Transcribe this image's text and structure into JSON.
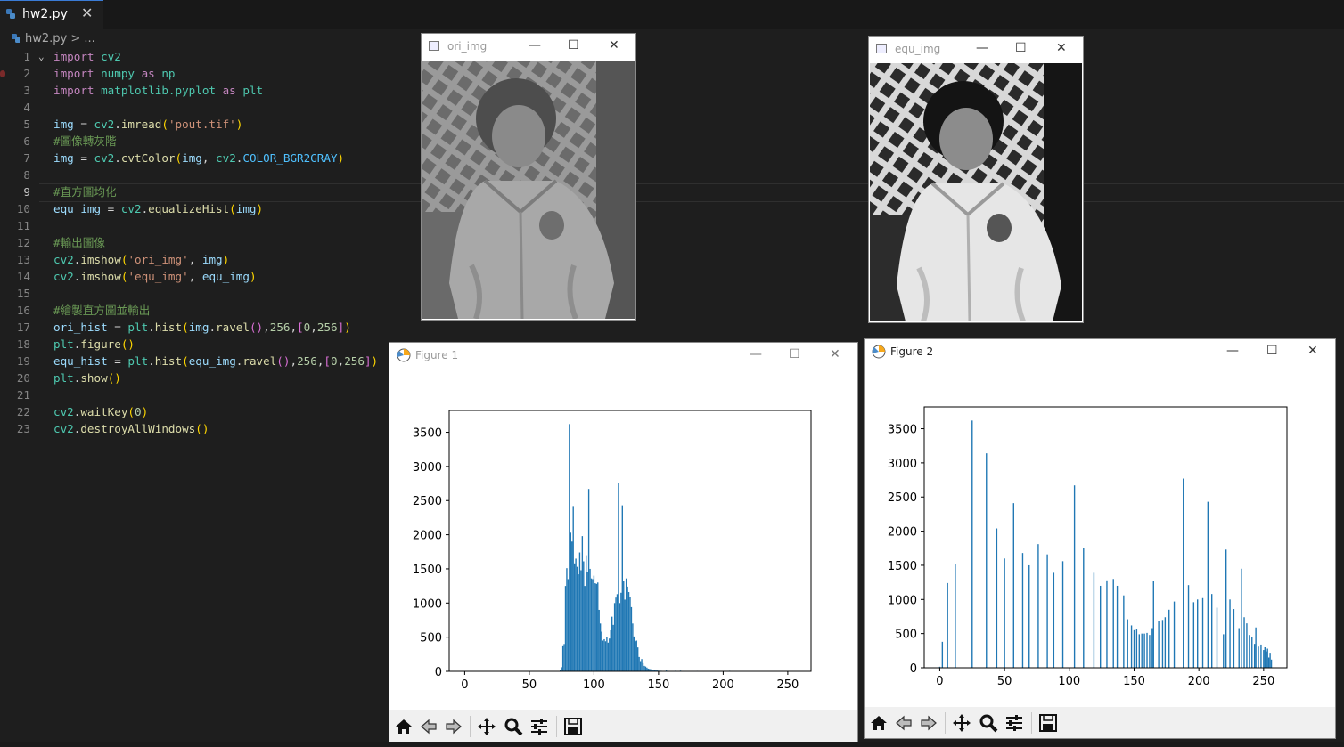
{
  "editor": {
    "tab_label": "hw2.py",
    "tab_close": "✕",
    "breadcrumb": "hw2.py > ...",
    "lines": [
      {
        "n": "1",
        "t": [
          [
            "kw",
            "import"
          ],
          [
            "",
            ""
          ],
          [
            "mod",
            " cv2"
          ]
        ]
      },
      {
        "n": "2",
        "t": [
          [
            "kw",
            "import"
          ],
          [
            "mod",
            " numpy"
          ],
          [
            "kw",
            " as"
          ],
          [
            "mod",
            " np"
          ]
        ]
      },
      {
        "n": "3",
        "t": [
          [
            "kw",
            "import"
          ],
          [
            "mod",
            " matplotlib.pyplot"
          ],
          [
            "kw",
            " as"
          ],
          [
            "mod",
            " plt"
          ]
        ]
      },
      {
        "n": "4",
        "t": []
      },
      {
        "n": "5",
        "t": [
          [
            "var",
            "img"
          ],
          [
            "",
            " = "
          ],
          [
            "mod",
            "cv2"
          ],
          [
            "",
            "."
          ],
          [
            "fn",
            "imread"
          ],
          [
            "p1",
            "("
          ],
          [
            "str",
            "'pout.tif'"
          ],
          [
            "p1",
            ")"
          ]
        ]
      },
      {
        "n": "6",
        "t": [
          [
            "cm",
            "#圖像轉灰階"
          ]
        ]
      },
      {
        "n": "7",
        "t": [
          [
            "var",
            "img"
          ],
          [
            "",
            " = "
          ],
          [
            "mod",
            "cv2"
          ],
          [
            "",
            "."
          ],
          [
            "fn",
            "cvtColor"
          ],
          [
            "p1",
            "("
          ],
          [
            "var",
            "img"
          ],
          [
            "",
            ", "
          ],
          [
            "mod",
            "cv2"
          ],
          [
            "",
            "."
          ],
          [
            "cst",
            "COLOR_BGR2GRAY"
          ],
          [
            "p1",
            ")"
          ]
        ]
      },
      {
        "n": "8",
        "t": []
      },
      {
        "n": "9",
        "t": [
          [
            "cm",
            "#直方圖均化"
          ]
        ]
      },
      {
        "n": "10",
        "t": [
          [
            "var",
            "equ_img"
          ],
          [
            "",
            " = "
          ],
          [
            "mod",
            "cv2"
          ],
          [
            "",
            "."
          ],
          [
            "fn",
            "equalizeHist"
          ],
          [
            "p1",
            "("
          ],
          [
            "var",
            "img"
          ],
          [
            "p1",
            ")"
          ]
        ]
      },
      {
        "n": "11",
        "t": []
      },
      {
        "n": "12",
        "t": [
          [
            "cm",
            "#輸出圖像"
          ]
        ]
      },
      {
        "n": "13",
        "t": [
          [
            "mod",
            "cv2"
          ],
          [
            "",
            "."
          ],
          [
            "fn",
            "imshow"
          ],
          [
            "p1",
            "("
          ],
          [
            "str",
            "'ori_img'"
          ],
          [
            "",
            ", "
          ],
          [
            "var",
            "img"
          ],
          [
            "p1",
            ")"
          ]
        ]
      },
      {
        "n": "14",
        "t": [
          [
            "mod",
            "cv2"
          ],
          [
            "",
            "."
          ],
          [
            "fn",
            "imshow"
          ],
          [
            "p1",
            "("
          ],
          [
            "str",
            "'equ_img'"
          ],
          [
            "",
            ", "
          ],
          [
            "var",
            "equ_img"
          ],
          [
            "p1",
            ")"
          ]
        ]
      },
      {
        "n": "15",
        "t": []
      },
      {
        "n": "16",
        "t": [
          [
            "cm",
            "#繪製直方圖並輸出"
          ]
        ]
      },
      {
        "n": "17",
        "t": [
          [
            "var",
            "ori_hist"
          ],
          [
            "",
            " = "
          ],
          [
            "mod",
            "plt"
          ],
          [
            "",
            "."
          ],
          [
            "fn",
            "hist"
          ],
          [
            "p1",
            "("
          ],
          [
            "var",
            "img"
          ],
          [
            "",
            "."
          ],
          [
            "fn",
            "ravel"
          ],
          [
            "p2",
            "()"
          ],
          [
            "",
            ","
          ],
          [
            "num",
            "256"
          ],
          [
            "",
            ","
          ],
          [
            "p2",
            "["
          ],
          [
            "num",
            "0"
          ],
          [
            "",
            ","
          ],
          [
            "num",
            "256"
          ],
          [
            "p2",
            "]"
          ],
          [
            "p1",
            ")"
          ]
        ]
      },
      {
        "n": "18",
        "t": [
          [
            "mod",
            "plt"
          ],
          [
            "",
            "."
          ],
          [
            "fn",
            "figure"
          ],
          [
            "p1",
            "()"
          ]
        ]
      },
      {
        "n": "19",
        "t": [
          [
            "var",
            "equ_hist"
          ],
          [
            "",
            " = "
          ],
          [
            "mod",
            "plt"
          ],
          [
            "",
            "."
          ],
          [
            "fn",
            "hist"
          ],
          [
            "p1",
            "("
          ],
          [
            "var",
            "equ_img"
          ],
          [
            "",
            "."
          ],
          [
            "fn",
            "ravel"
          ],
          [
            "p2",
            "()"
          ],
          [
            "",
            ","
          ],
          [
            "num",
            "256"
          ],
          [
            "",
            ","
          ],
          [
            "p2",
            "["
          ],
          [
            "num",
            "0"
          ],
          [
            "",
            ","
          ],
          [
            "num",
            "256"
          ],
          [
            "p2",
            "]"
          ],
          [
            "p1",
            ")"
          ]
        ]
      },
      {
        "n": "20",
        "t": [
          [
            "mod",
            "plt"
          ],
          [
            "",
            "."
          ],
          [
            "fn",
            "show"
          ],
          [
            "p1",
            "()"
          ]
        ]
      },
      {
        "n": "21",
        "t": []
      },
      {
        "n": "22",
        "t": [
          [
            "mod",
            "cv2"
          ],
          [
            "",
            "."
          ],
          [
            "fn",
            "waitKey"
          ],
          [
            "p1",
            "("
          ],
          [
            "num",
            "0"
          ],
          [
            "p1",
            ")"
          ]
        ]
      },
      {
        "n": "23",
        "t": [
          [
            "mod",
            "cv2"
          ],
          [
            "",
            "."
          ],
          [
            "fn",
            "destroyAllWindows"
          ],
          [
            "p1",
            "()"
          ]
        ]
      }
    ]
  },
  "windows": {
    "ori": {
      "title": "ori_img"
    },
    "equ": {
      "title": "equ_img"
    },
    "fig1": {
      "title": "Figure 1"
    },
    "fig2": {
      "title": "Figure 2"
    },
    "min_glyph": "—",
    "max_glyph": "☐",
    "close_glyph": "✕"
  },
  "colors": {
    "bar": "#1f77b4",
    "accent_tab": "#3a7bd5"
  },
  "chart_data": [
    {
      "type": "bar",
      "title": "",
      "xlim": [
        -12,
        268
      ],
      "ylim": [
        0,
        3820
      ],
      "xticks": [
        0,
        50,
        100,
        150,
        200,
        250
      ],
      "yticks": [
        0,
        500,
        1000,
        1500,
        2000,
        2500,
        3000,
        3500
      ],
      "bins": [
        [
          74,
          15
        ],
        [
          75,
          60
        ],
        [
          76,
          380
        ],
        [
          77,
          400
        ],
        [
          78,
          1250
        ],
        [
          79,
          1510
        ],
        [
          80,
          1350
        ],
        [
          81,
          3620
        ],
        [
          82,
          2030
        ],
        [
          83,
          1900
        ],
        [
          84,
          2420
        ],
        [
          85,
          1580
        ],
        [
          86,
          1650
        ],
        [
          87,
          1530
        ],
        [
          88,
          1420
        ],
        [
          89,
          1740
        ],
        [
          90,
          1480
        ],
        [
          91,
          1980
        ],
        [
          92,
          1610
        ],
        [
          93,
          1250
        ],
        [
          94,
          1700
        ],
        [
          95,
          1450
        ],
        [
          96,
          2670
        ],
        [
          97,
          1500
        ],
        [
          98,
          1360
        ],
        [
          99,
          1350
        ],
        [
          100,
          1400
        ],
        [
          101,
          1290
        ],
        [
          102,
          1280
        ],
        [
          103,
          1300
        ],
        [
          104,
          900
        ],
        [
          105,
          700
        ],
        [
          106,
          580
        ],
        [
          107,
          450
        ],
        [
          108,
          470
        ],
        [
          109,
          440
        ],
        [
          110,
          500
        ],
        [
          111,
          420
        ],
        [
          112,
          480
        ],
        [
          113,
          600
        ],
        [
          114,
          800
        ],
        [
          115,
          680
        ],
        [
          116,
          1000
        ],
        [
          117,
          1080
        ],
        [
          118,
          1130
        ],
        [
          119,
          2760
        ],
        [
          120,
          1000
        ],
        [
          121,
          1150
        ],
        [
          122,
          2430
        ],
        [
          123,
          1320
        ],
        [
          124,
          1050
        ],
        [
          125,
          1360
        ],
        [
          126,
          1240
        ],
        [
          127,
          1160
        ],
        [
          128,
          1090
        ],
        [
          129,
          940
        ],
        [
          130,
          700
        ],
        [
          131,
          510
        ],
        [
          132,
          440
        ],
        [
          133,
          450
        ],
        [
          134,
          350
        ],
        [
          135,
          210
        ],
        [
          136,
          150
        ],
        [
          137,
          180
        ],
        [
          138,
          120
        ],
        [
          139,
          80
        ],
        [
          140,
          70
        ],
        [
          141,
          55
        ],
        [
          142,
          40
        ],
        [
          143,
          35
        ],
        [
          144,
          30
        ],
        [
          145,
          25
        ],
        [
          146,
          20
        ],
        [
          147,
          22
        ],
        [
          148,
          15
        ],
        [
          149,
          12
        ],
        [
          150,
          10
        ],
        [
          152,
          8
        ],
        [
          154,
          6
        ],
        [
          156,
          12
        ],
        [
          159,
          5
        ],
        [
          163,
          8
        ],
        [
          167,
          10
        ],
        [
          173,
          5
        ],
        [
          180,
          7
        ],
        [
          187,
          6
        ],
        [
          193,
          5
        ],
        [
          205,
          8
        ]
      ]
    },
    {
      "type": "bar",
      "title": "",
      "xlim": [
        -12,
        268
      ],
      "ylim": [
        0,
        3820
      ],
      "xticks": [
        0,
        50,
        100,
        150,
        200,
        250
      ],
      "yticks": [
        0,
        500,
        1000,
        1500,
        2000,
        2500,
        3000,
        3500
      ],
      "bins": [
        [
          0,
          15
        ],
        [
          2,
          380
        ],
        [
          6,
          1240
        ],
        [
          12,
          1520
        ],
        [
          25,
          3620
        ],
        [
          36,
          3140
        ],
        [
          44,
          2040
        ],
        [
          50,
          1600
        ],
        [
          57,
          2410
        ],
        [
          64,
          1680
        ],
        [
          69,
          1500
        ],
        [
          76,
          1810
        ],
        [
          83,
          1660
        ],
        [
          88,
          1390
        ],
        [
          95,
          1560
        ],
        [
          104,
          2670
        ],
        [
          111,
          1760
        ],
        [
          119,
          1390
        ],
        [
          124,
          1200
        ],
        [
          129,
          1280
        ],
        [
          134,
          1300
        ],
        [
          137,
          1200
        ],
        [
          142,
          1060
        ],
        [
          145,
          710
        ],
        [
          148,
          620
        ],
        [
          150,
          550
        ],
        [
          152,
          560
        ],
        [
          154,
          490
        ],
        [
          156,
          500
        ],
        [
          158,
          500
        ],
        [
          160,
          510
        ],
        [
          162,
          480
        ],
        [
          164,
          580
        ],
        [
          165,
          1270
        ],
        [
          169,
          680
        ],
        [
          172,
          700
        ],
        [
          174,
          740
        ],
        [
          177,
          850
        ],
        [
          181,
          970
        ],
        [
          188,
          2770
        ],
        [
          192,
          1210
        ],
        [
          196,
          960
        ],
        [
          199,
          1000
        ],
        [
          203,
          1020
        ],
        [
          207,
          2430
        ],
        [
          210,
          1080
        ],
        [
          214,
          880
        ],
        [
          219,
          490
        ],
        [
          221,
          1730
        ],
        [
          224,
          1000
        ],
        [
          227,
          860
        ],
        [
          231,
          580
        ],
        [
          233,
          1450
        ],
        [
          235,
          740
        ],
        [
          237,
          650
        ],
        [
          239,
          480
        ],
        [
          241,
          450
        ],
        [
          243,
          350
        ],
        [
          244,
          590
        ],
        [
          246,
          310
        ],
        [
          248,
          340
        ],
        [
          250,
          260
        ],
        [
          251,
          300
        ],
        [
          252,
          240
        ],
        [
          253,
          280
        ],
        [
          254,
          150
        ],
        [
          255,
          220
        ],
        [
          256,
          120
        ]
      ]
    }
  ]
}
